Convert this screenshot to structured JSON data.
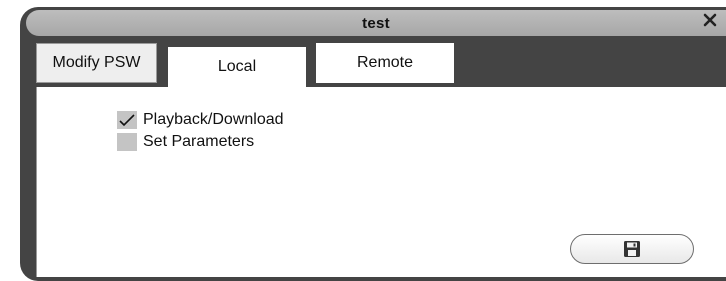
{
  "window": {
    "title": "test"
  },
  "tabs": [
    {
      "label": "Modify PSW"
    },
    {
      "label": "Local"
    },
    {
      "label": "Remote"
    }
  ],
  "permissions": [
    {
      "label": "Playback/Download",
      "checked": true
    },
    {
      "label": "Set Parameters",
      "checked": false
    }
  ],
  "icons": {
    "close": "close-icon",
    "save": "floppy-disk-icon"
  },
  "colors": {
    "frame": "#444444",
    "titlebar": "#b3b3b3",
    "checkbox": "#c4c4c4"
  }
}
